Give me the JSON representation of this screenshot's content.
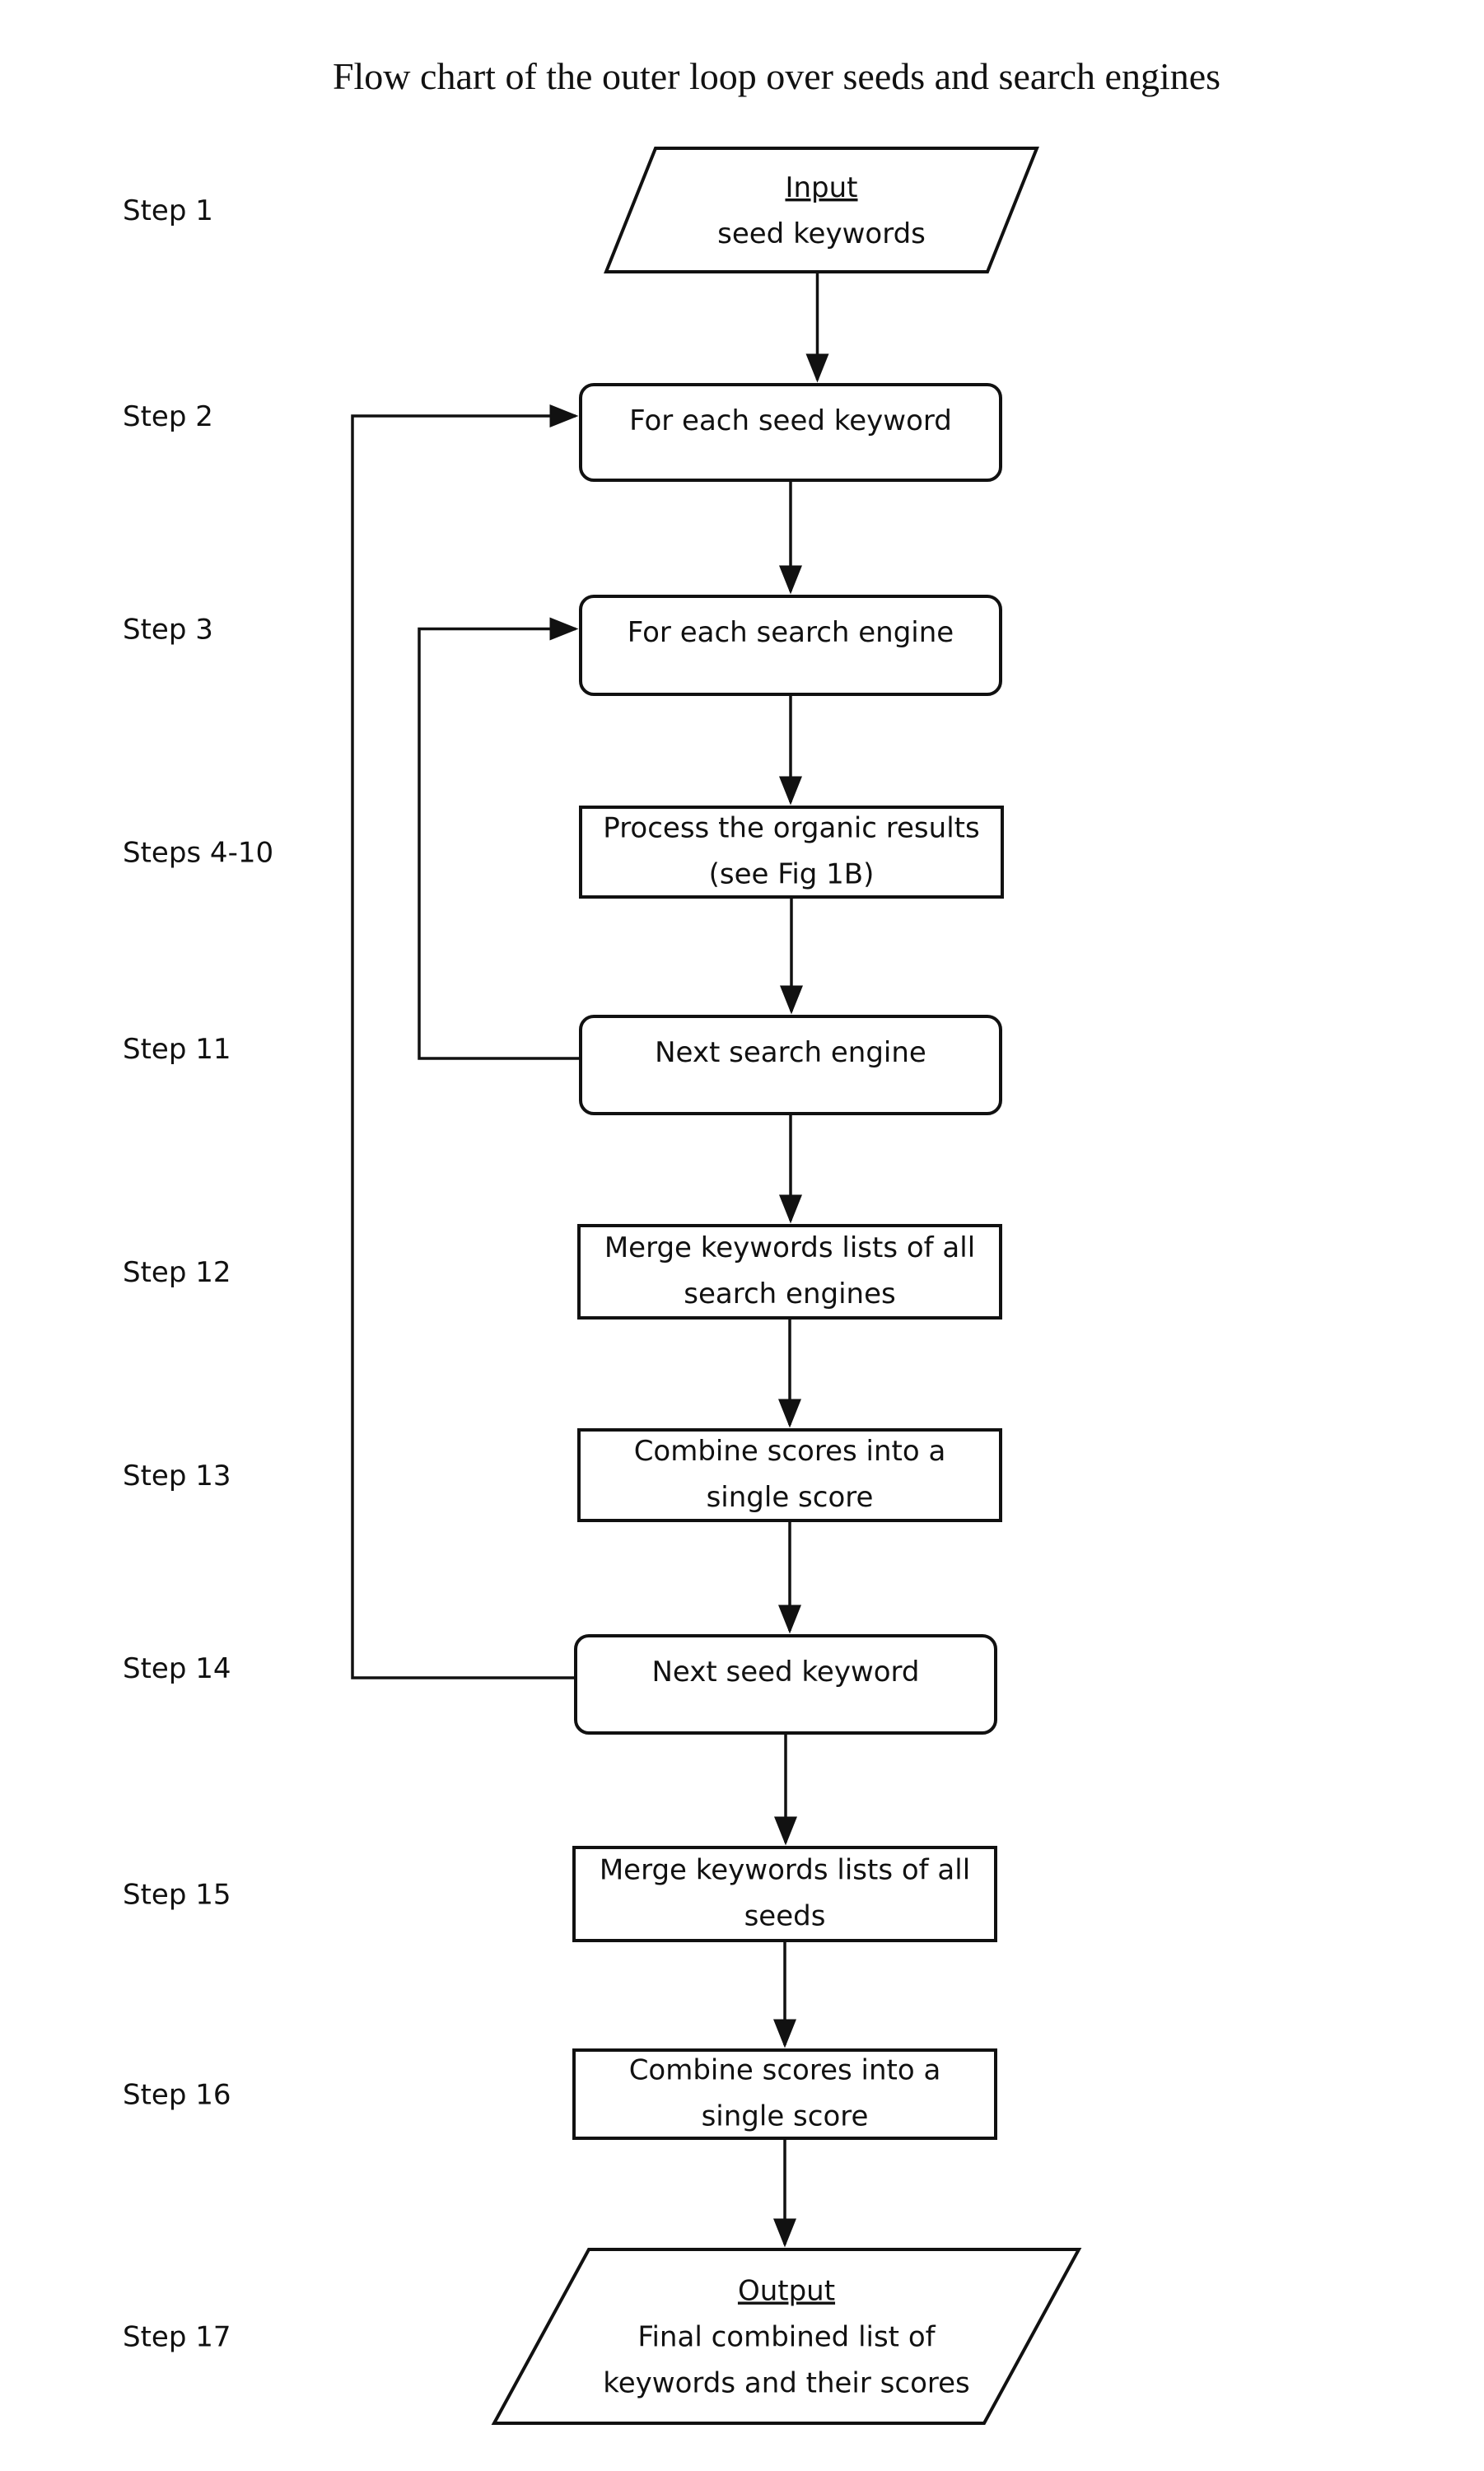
{
  "title": "Flow chart of the outer loop over seeds and search engines",
  "steps": [
    {
      "id": "s1",
      "label": "Step 1",
      "shape": "parallelogram",
      "heading": "Input",
      "lines": [
        "seed keywords"
      ]
    },
    {
      "id": "s2",
      "label": "Step 2",
      "shape": "rounded",
      "lines": [
        "For each seed keyword"
      ]
    },
    {
      "id": "s3",
      "label": "Step 3",
      "shape": "rounded",
      "lines": [
        "For each search engine"
      ]
    },
    {
      "id": "s4",
      "label": "Steps 4-10",
      "shape": "rect",
      "lines": [
        "Process the organic results",
        "(see Fig 1B)"
      ]
    },
    {
      "id": "s11",
      "label": "Step 11",
      "shape": "rounded",
      "lines": [
        "Next search engine"
      ]
    },
    {
      "id": "s12",
      "label": "Step 12",
      "shape": "rect",
      "lines": [
        "Merge keywords lists of all",
        "search engines"
      ]
    },
    {
      "id": "s13",
      "label": "Step 13",
      "shape": "rect",
      "lines": [
        "Combine scores into a",
        "single score"
      ]
    },
    {
      "id": "s14",
      "label": "Step 14",
      "shape": "rounded",
      "lines": [
        "Next seed keyword"
      ]
    },
    {
      "id": "s15",
      "label": "Step 15",
      "shape": "rect",
      "lines": [
        "Merge keywords lists of all",
        "seeds"
      ]
    },
    {
      "id": "s16",
      "label": "Step 16",
      "shape": "rect",
      "lines": [
        "Combine scores into a",
        "single score"
      ]
    },
    {
      "id": "s17",
      "label": "Step 17",
      "shape": "parallelogram",
      "heading": "Output",
      "lines": [
        "Final combined list of",
        "keywords and their scores"
      ]
    }
  ],
  "edges": [
    {
      "from": "s1",
      "to": "s2",
      "type": "forward"
    },
    {
      "from": "s2",
      "to": "s3",
      "type": "forward"
    },
    {
      "from": "s3",
      "to": "s4",
      "type": "forward"
    },
    {
      "from": "s4",
      "to": "s11",
      "type": "forward"
    },
    {
      "from": "s11",
      "to": "s3",
      "type": "loop-back",
      "loop": "inner"
    },
    {
      "from": "s11",
      "to": "s12",
      "type": "forward"
    },
    {
      "from": "s12",
      "to": "s13",
      "type": "forward"
    },
    {
      "from": "s13",
      "to": "s14",
      "type": "forward"
    },
    {
      "from": "s14",
      "to": "s2",
      "type": "loop-back",
      "loop": "outer"
    },
    {
      "from": "s14",
      "to": "s15",
      "type": "forward"
    },
    {
      "from": "s15",
      "to": "s16",
      "type": "forward"
    },
    {
      "from": "s16",
      "to": "s17",
      "type": "forward"
    }
  ]
}
